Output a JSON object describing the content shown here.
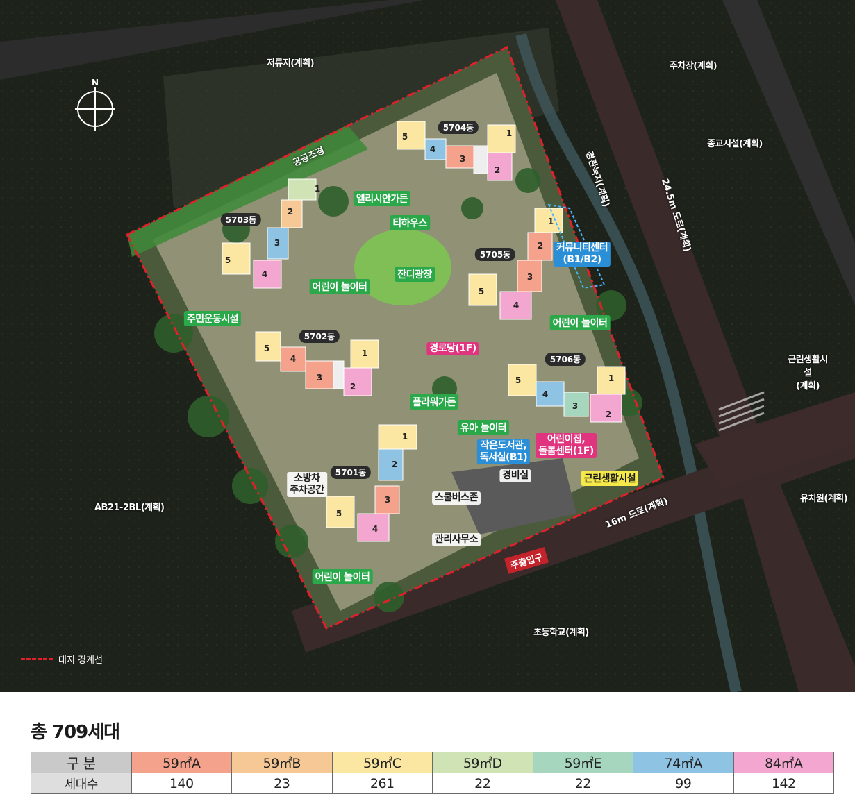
{
  "map": {
    "compass": "N",
    "surroundings": {
      "reservoir": "저류지(계획)",
      "parking": "주차장(계획)",
      "religious": "종교시설(계획)",
      "green_buffer": "경관녹지(계획)",
      "road_245": "24.5m 도로(계획)",
      "neighborhood_retail": "근린생활시설\n(계획)",
      "kindergarten": "유치원(계획)",
      "road_16": "16m 도로(계획)",
      "elementary": "초등학교(계획)",
      "ab21": "AB21-2BL(계획)",
      "public_landscape": "공공조경"
    },
    "buildings": [
      {
        "name": "5701동",
        "units": [
          "1",
          "2",
          "3",
          "4",
          "5"
        ]
      },
      {
        "name": "5702동",
        "units": [
          "1",
          "2",
          "3",
          "4",
          "5"
        ]
      },
      {
        "name": "5703동",
        "units": [
          "1",
          "2",
          "3",
          "4",
          "5"
        ]
      },
      {
        "name": "5704동",
        "units": [
          "1",
          "2",
          "3",
          "4",
          "5"
        ]
      },
      {
        "name": "5705동",
        "units": [
          "1",
          "2",
          "3",
          "4",
          "5"
        ]
      },
      {
        "name": "5706동",
        "units": [
          "1",
          "2",
          "3",
          "4",
          "5"
        ]
      }
    ],
    "facilities": {
      "elysian_garden": "엘리시안가든",
      "tea_house": "티하우스",
      "lawn_plaza": "잔디광장",
      "playground": "어린이 놀이터",
      "resident_sports": "주민운동시설",
      "senior_center": "경로당(1F)",
      "flower_garden": "플라워가든",
      "toddler_playground": "유아 놀이터",
      "small_library": "작은도서관,\n독서실(B1)",
      "daycare": "어린이집,\n돌봄센터(1F)",
      "community_center": "커뮤니티센터\n(B1/B2)",
      "neighborhood_facility": "근린생활시설",
      "guard_room": "경비실",
      "school_bus_zone": "스쿨버스존",
      "management_office": "관리사무소",
      "fire_truck_parking": "소방차\n주차공간",
      "main_entrance": "주출입구"
    },
    "legend": {
      "boundary": "대지 경계선",
      "boundary_color": "#e0202a"
    }
  },
  "summary": {
    "total": "총 709세대"
  },
  "unit_table": {
    "header_label": "구  분",
    "row_label": "세대수",
    "types": [
      {
        "name": "59㎡A",
        "count": "140",
        "color": "#f4a28b"
      },
      {
        "name": "59㎡B",
        "count": "23",
        "color": "#f6c896"
      },
      {
        "name": "59㎡C",
        "count": "261",
        "color": "#fbe7a1"
      },
      {
        "name": "59㎡D",
        "count": "22",
        "color": "#cfe3b4"
      },
      {
        "name": "59㎡E",
        "count": "22",
        "color": "#a7d6bf"
      },
      {
        "name": "74㎡A",
        "count": "99",
        "color": "#8fc3e3"
      },
      {
        "name": "84㎡A",
        "count": "142",
        "color": "#f3a6cf"
      }
    ]
  }
}
